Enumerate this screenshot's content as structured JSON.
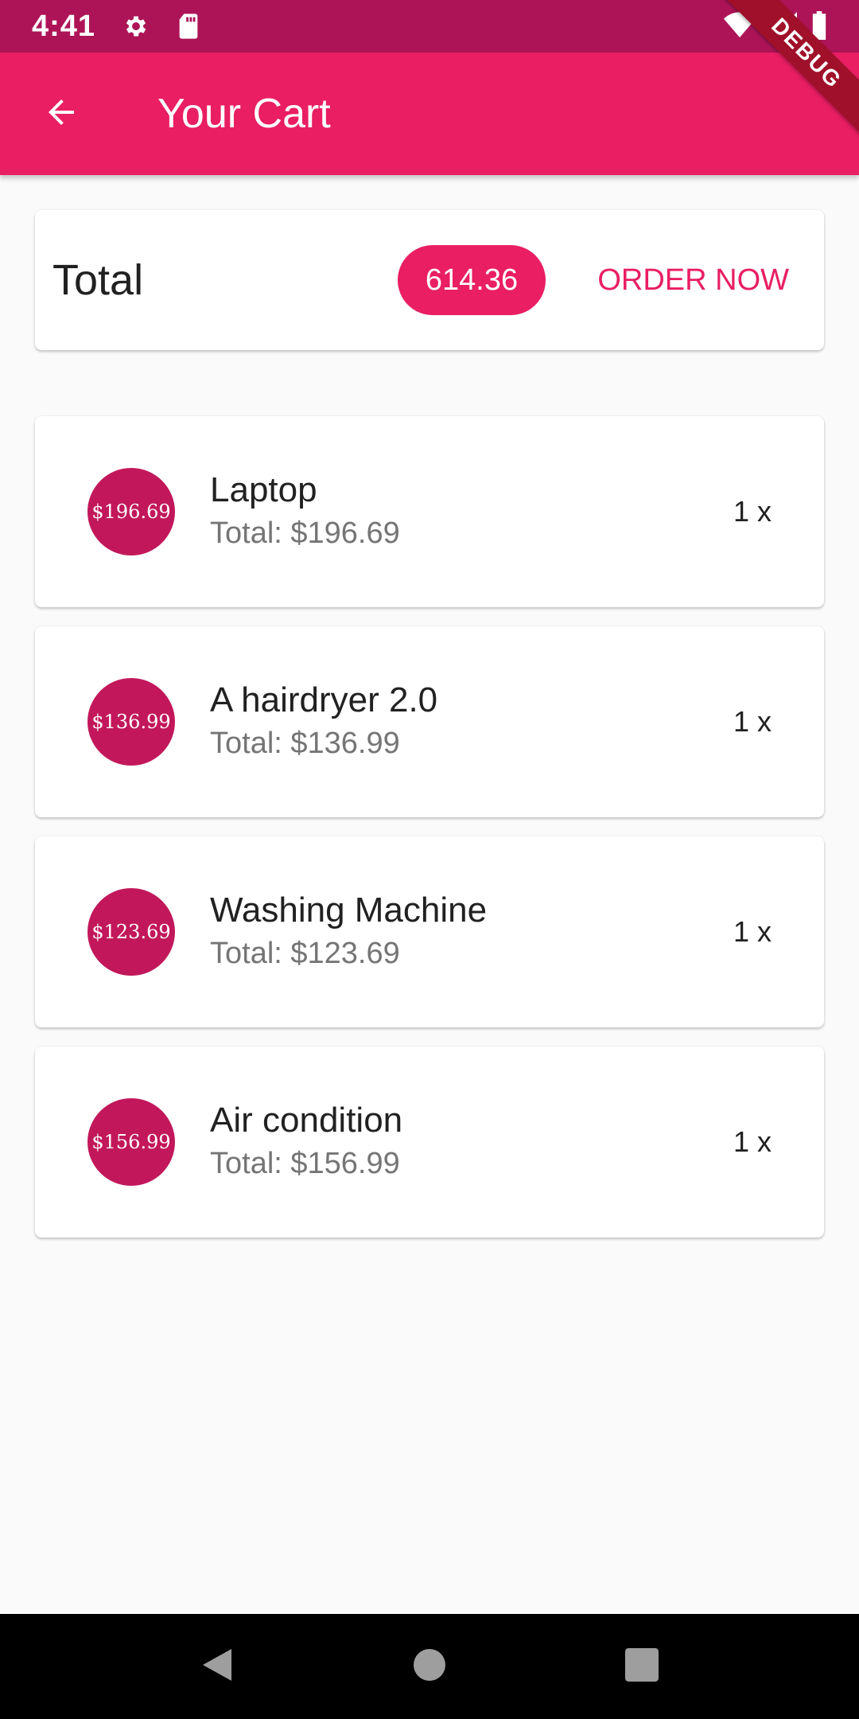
{
  "status_bar": {
    "time": "4:41",
    "icons": [
      "gear-icon",
      "sd-card-icon",
      "wifi-icon",
      "signal-icon",
      "battery-icon"
    ]
  },
  "app_bar": {
    "title": "Your Cart",
    "back_icon": "arrow-left-icon",
    "debug_label": "DEBUG"
  },
  "summary": {
    "label": "Total",
    "amount": "614.36",
    "order_label": "ORDER NOW"
  },
  "items": [
    {
      "price": "$196.69",
      "title": "Laptop",
      "subtitle": "Total: $196.69",
      "qty": "1 x"
    },
    {
      "price": "$136.99",
      "title": "A hairdryer 2.0",
      "subtitle": "Total: $136.99",
      "qty": "1 x"
    },
    {
      "price": "$123.69",
      "title": "Washing Machine",
      "subtitle": "Total: $123.69",
      "qty": "1 x"
    },
    {
      "price": "$156.99",
      "title": "Air condition",
      "subtitle": "Total: $156.99",
      "qty": "1 x"
    }
  ],
  "nav_bar": {
    "icons": [
      "back-triangle-icon",
      "home-circle-icon",
      "recents-square-icon"
    ]
  },
  "colors": {
    "primary": "#e91e63",
    "primary_dark": "#ad1457",
    "avatar": "#c2185b",
    "background": "#fafafa"
  }
}
